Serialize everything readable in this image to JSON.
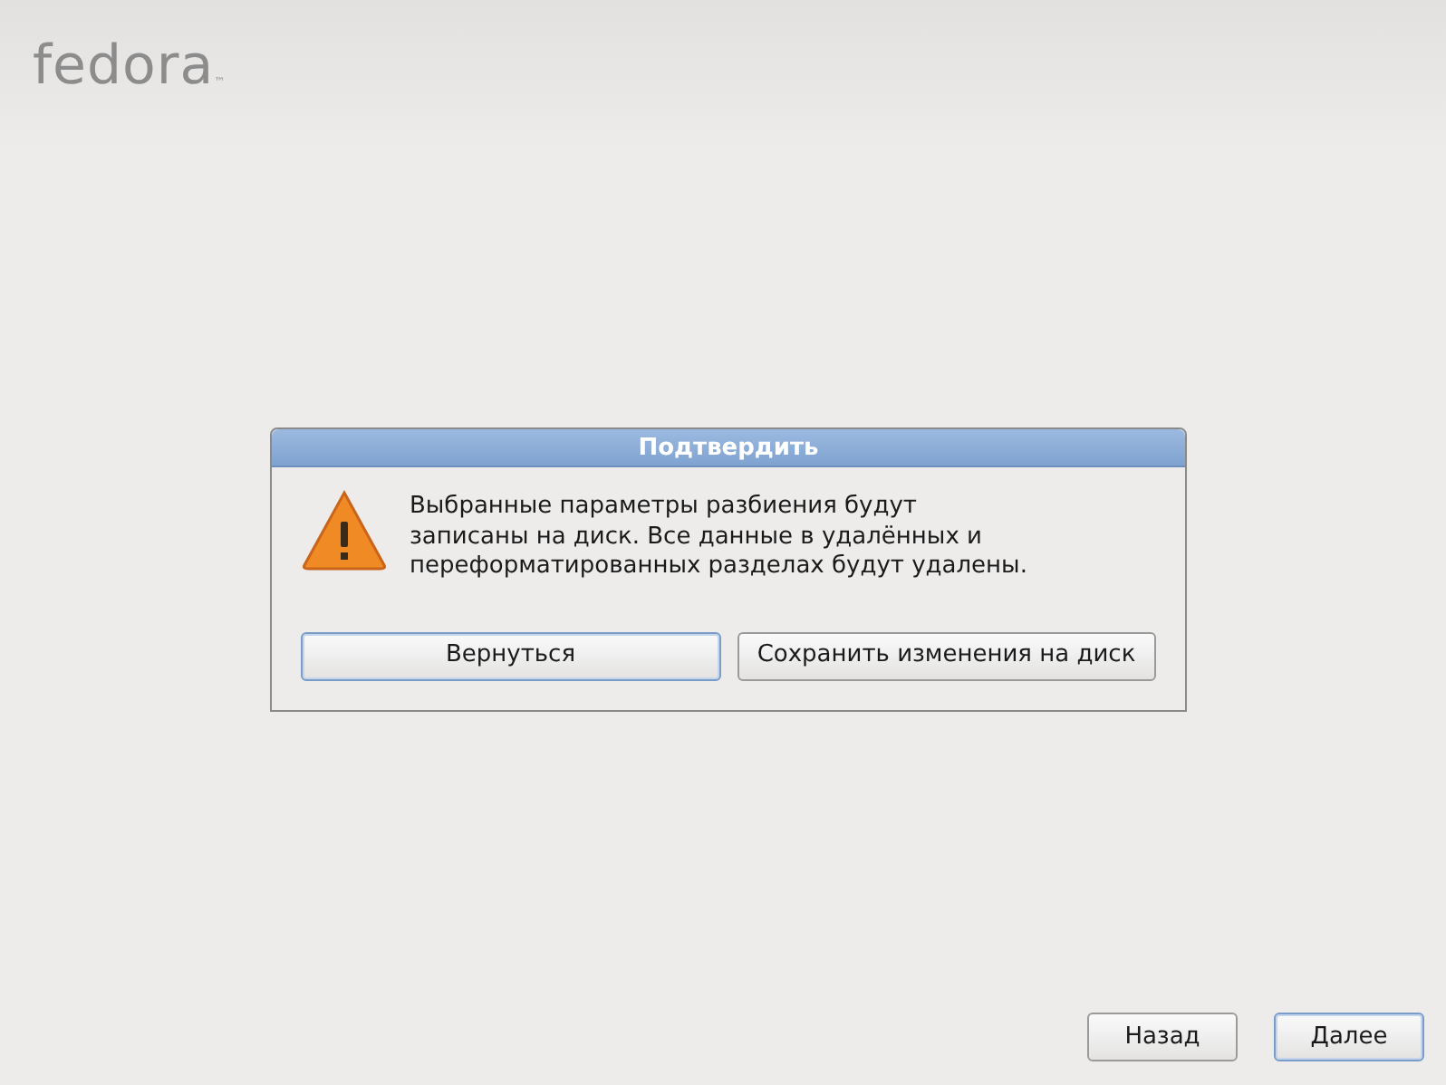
{
  "logo": {
    "text": "fedora",
    "trademark": "™"
  },
  "dialog": {
    "title": "Подтвердить",
    "message": "Выбранные параметры разбиения будут\nзаписаны на диск. Все данные в удалённых и\nпереформатированных разделах будут удалены.",
    "buttons": [
      {
        "label": "Вернуться",
        "focused": true
      },
      {
        "label": "Сохранить изменения на диск",
        "focused": false
      }
    ]
  },
  "navigation": [
    {
      "label": "Назад",
      "focused": false
    },
    {
      "label": "Далее",
      "focused": true
    }
  ]
}
